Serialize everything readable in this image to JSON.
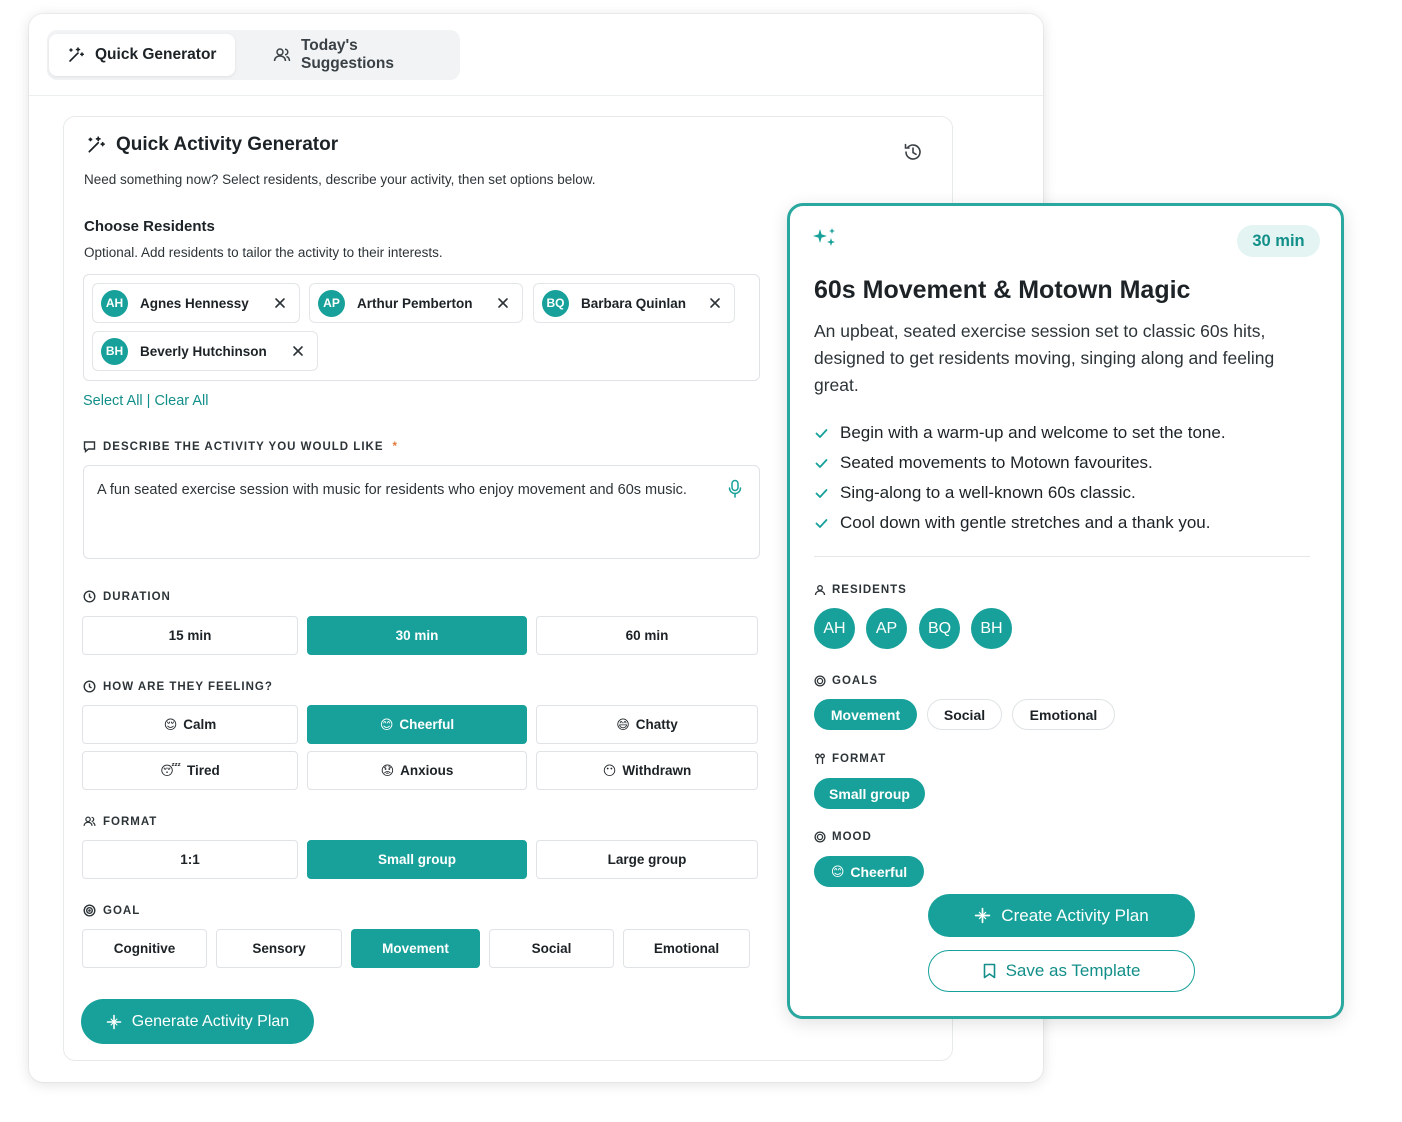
{
  "tabs": {
    "quick_generator": "Quick Generator",
    "todays_suggestions": "Today's Suggestions"
  },
  "generator": {
    "title": "Quick Activity Generator",
    "subtitle": "Need something now? Select residents, describe your activity, then set options below.",
    "choose_residents": {
      "heading": "Choose Residents",
      "subtitle": "Optional. Add residents to tailor the activity to their interests.",
      "residents": [
        {
          "initials": "AH",
          "name": "Agnes Hennessy"
        },
        {
          "initials": "AP",
          "name": "Arthur Pemberton"
        },
        {
          "initials": "BQ",
          "name": "Barbara Quinlan"
        },
        {
          "initials": "BH",
          "name": "Beverly Hutchinson"
        }
      ],
      "select_all": "Select All",
      "separator": "|",
      "clear_all": "Clear All"
    },
    "describe": {
      "label": "DESCRIBE THE ACTIVITY YOU WOULD LIKE",
      "required_mark": "*",
      "value": "A fun seated exercise session with music for residents who enjoy movement and 60s music."
    },
    "duration": {
      "label": "DURATION",
      "options": [
        "15 min",
        "30 min",
        "60 min"
      ],
      "selected": "30 min"
    },
    "feeling": {
      "label": "HOW ARE THEY FEELING?",
      "options": [
        {
          "emoji": "😌",
          "label": "Calm"
        },
        {
          "emoji": "😊",
          "label": "Cheerful"
        },
        {
          "emoji": "😄",
          "label": "Chatty"
        },
        {
          "emoji": "😴",
          "label": "Tired"
        },
        {
          "emoji": "😟",
          "label": "Anxious"
        },
        {
          "emoji": "😶",
          "label": "Withdrawn"
        }
      ],
      "selected": "Cheerful"
    },
    "format": {
      "label": "FORMAT",
      "options": [
        "1:1",
        "Small group",
        "Large group"
      ],
      "selected": "Small group"
    },
    "goal": {
      "label": "GOAL",
      "options": [
        "Cognitive",
        "Sensory",
        "Movement",
        "Social",
        "Emotional"
      ],
      "selected": "Movement"
    },
    "generate_button": "Generate Activity Plan"
  },
  "result": {
    "duration_badge": "30 min",
    "title": "60s Movement & Motown Magic",
    "description": "An upbeat, seated exercise session set to classic 60s hits, designed to get residents moving, singing along and feeling great.",
    "steps": [
      "Begin with a warm-up and welcome to set the tone.",
      "Seated movements to Motown favourites.",
      "Sing-along to a well-known 60s classic.",
      "Cool down with gentle stretches and a thank you."
    ],
    "residents_label": "RESIDENTS",
    "residents": [
      "AH",
      "AP",
      "BQ",
      "BH"
    ],
    "goals_label": "GOALS",
    "goals": [
      {
        "label": "Movement",
        "selected": true
      },
      {
        "label": "Social",
        "selected": false
      },
      {
        "label": "Emotional",
        "selected": false
      }
    ],
    "format_label": "FORMAT",
    "format": "Small group",
    "mood_label": "MOOD",
    "mood": {
      "emoji": "😊",
      "label": "Cheerful"
    },
    "create_button": "Create Activity Plan",
    "save_button": "Save as Template"
  },
  "colors": {
    "accent": "#17a19a",
    "accent_text": "#138f89",
    "accent_light": "#e3f4f3",
    "required": "#e07b39"
  }
}
